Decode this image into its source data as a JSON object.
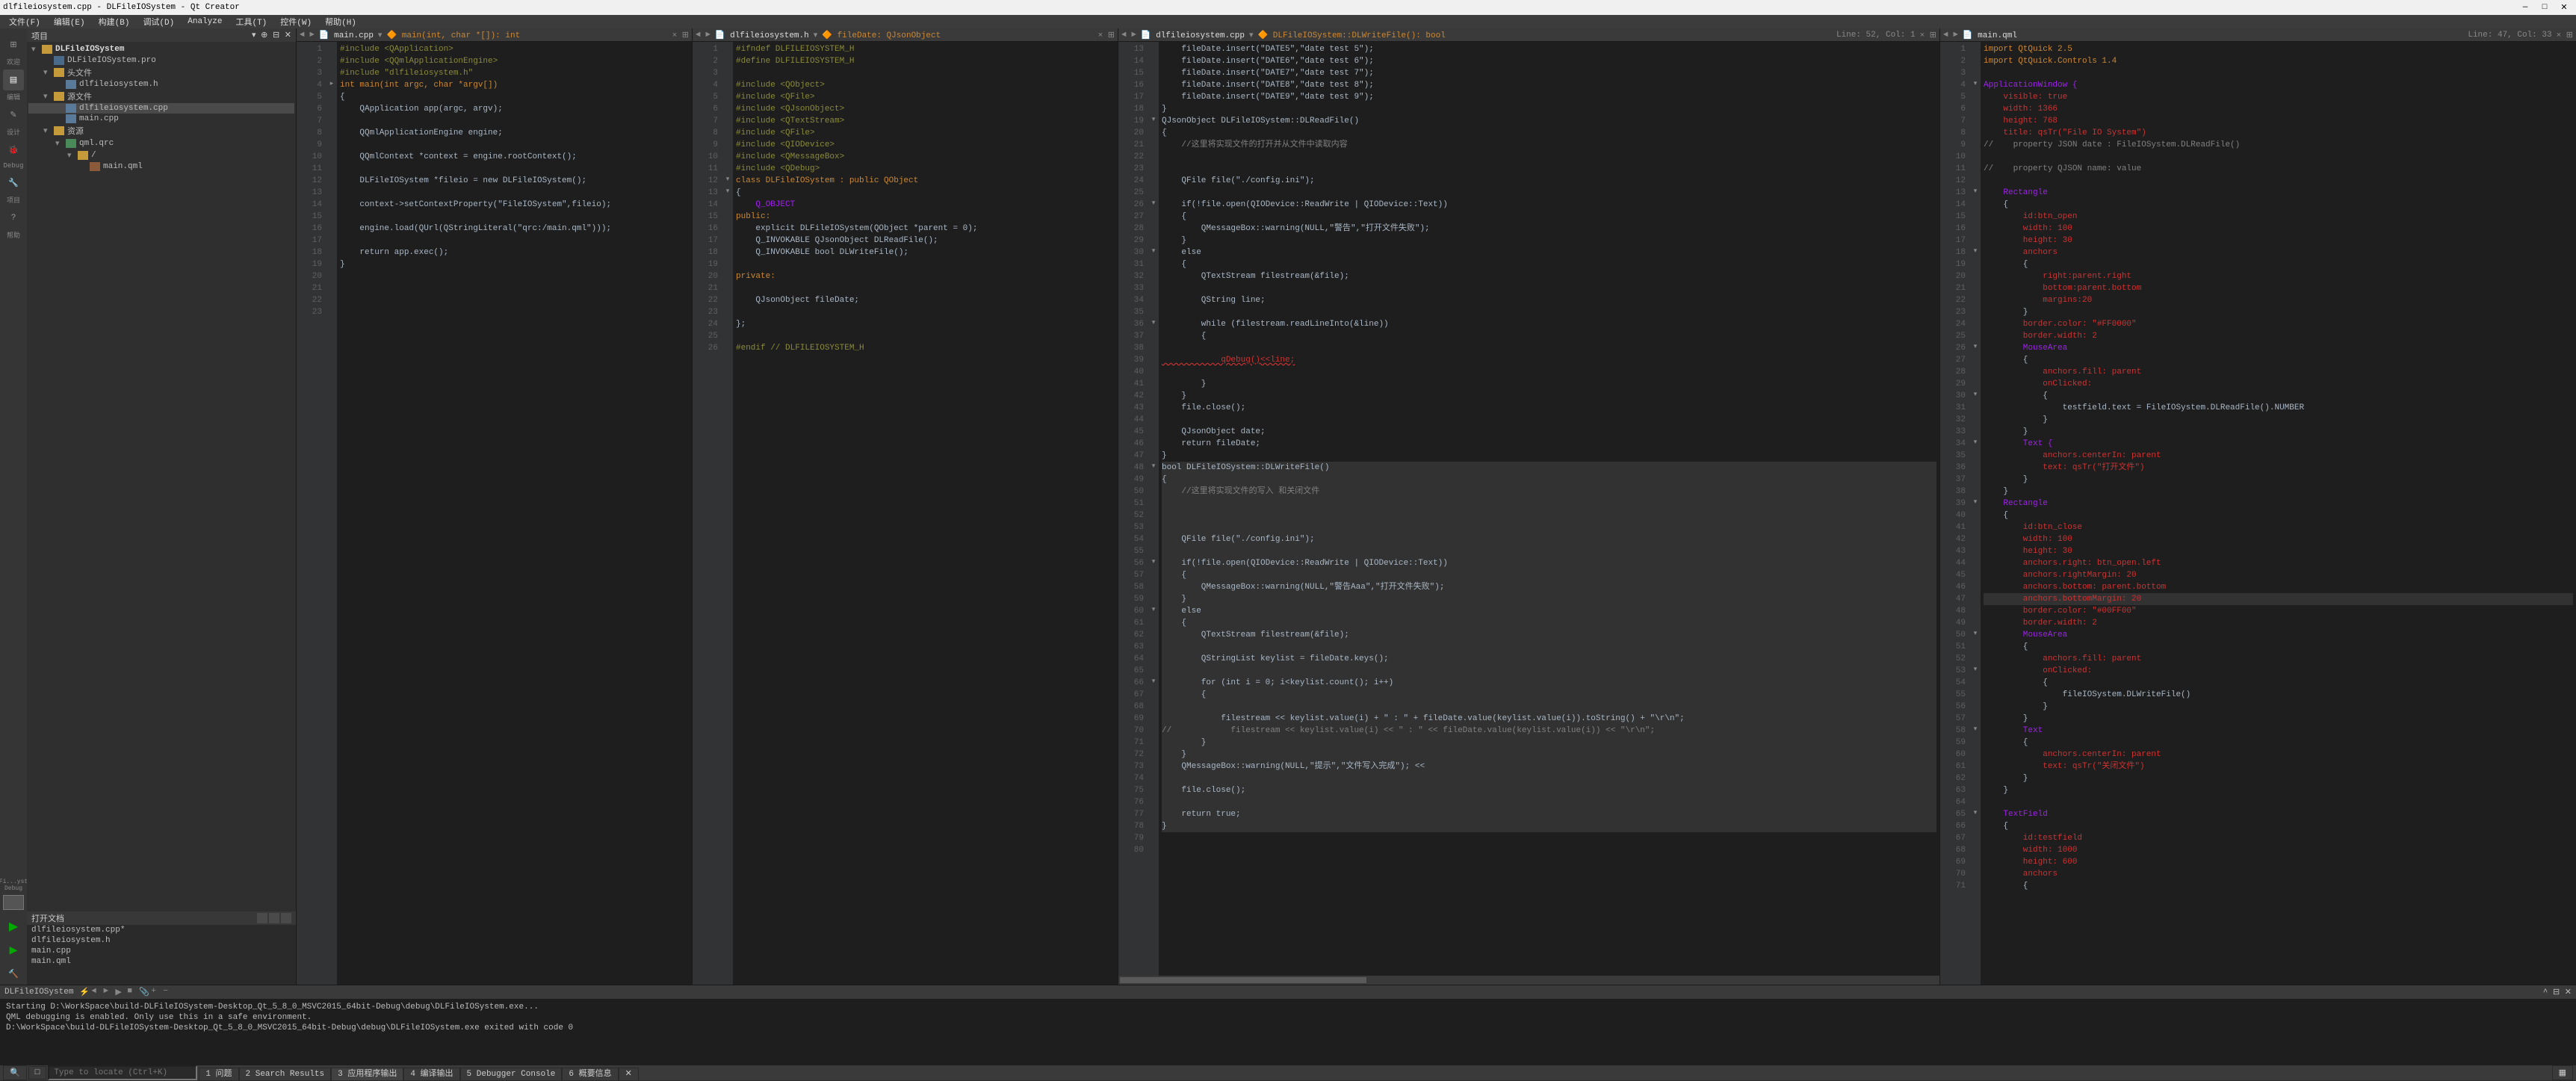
{
  "title": "dlfileiosystem.cpp - DLFileIOSystem - Qt Creator",
  "menu": [
    "文件(F)",
    "编辑(E)",
    "构建(B)",
    "调试(D)",
    "Analyze",
    "工具(T)",
    "控件(W)",
    "帮助(H)"
  ],
  "project_header": "项目",
  "tree": [
    {
      "d": 0,
      "exp": "▾",
      "ico": "folder",
      "txt": "DLFileIOSystem",
      "bold": true
    },
    {
      "d": 1,
      "exp": " ",
      "ico": "folderb",
      "txt": "DLFileIOSystem.pro"
    },
    {
      "d": 1,
      "exp": "▾",
      "ico": "folder",
      "txt": "头文件"
    },
    {
      "d": 2,
      "exp": " ",
      "ico": "h",
      "txt": "dlfileiosystem.h"
    },
    {
      "d": 1,
      "exp": "▾",
      "ico": "folder",
      "txt": "源文件"
    },
    {
      "d": 2,
      "exp": " ",
      "ico": "cpp",
      "txt": "dlfileiosystem.cpp",
      "sel": true
    },
    {
      "d": 2,
      "exp": " ",
      "ico": "cpp",
      "txt": "main.cpp"
    },
    {
      "d": 1,
      "exp": "▾",
      "ico": "folder",
      "txt": "资源"
    },
    {
      "d": 2,
      "exp": "▾",
      "ico": "qrc",
      "txt": "qml.qrc"
    },
    {
      "d": 3,
      "exp": "▾",
      "ico": "folder",
      "txt": "/"
    },
    {
      "d": 4,
      "exp": " ",
      "ico": "qml",
      "txt": "main.qml"
    }
  ],
  "open_header": "打开文档",
  "open_files": [
    "dlfileiosystem.cpp*",
    "dlfileiosystem.h",
    "main.cpp",
    "main.qml"
  ],
  "editors": [
    {
      "tab": {
        "nav": "◄ ►",
        "ico": "cpp",
        "fname": "main.cpp",
        "func": "main(int, char *[]): int",
        "x": "×  ⊞"
      },
      "start": 1,
      "lines": [
        {
          "t": "#include <QApplication>",
          "cls": "pp"
        },
        {
          "t": "#include <QQmlApplicationEngine>",
          "cls": "pp"
        },
        {
          "t": "#include \"dlfileiosystem.h\"",
          "cls": "pp"
        },
        {
          "t": "int main(int argc, char *argv[])",
          "cls": "kw",
          "fold": "▸"
        },
        {
          "t": "{"
        },
        {
          "t": "    QApplication app(argc, argv);"
        },
        {
          "t": ""
        },
        {
          "t": "    QQmlApplicationEngine engine;"
        },
        {
          "t": ""
        },
        {
          "t": "    QQmlContext *context = engine.rootContext();"
        },
        {
          "t": ""
        },
        {
          "t": "    DLFileIOSystem *fileio = new DLFileIOSystem();"
        },
        {
          "t": ""
        },
        {
          "t": "    context->setContextProperty(\"FileIOSystem\",fileio);"
        },
        {
          "t": ""
        },
        {
          "t": "    engine.load(QUrl(QStringLiteral(\"qrc:/main.qml\")));"
        },
        {
          "t": ""
        },
        {
          "t": "    return app.exec();"
        },
        {
          "t": "}"
        },
        {
          "t": ""
        },
        {
          "t": ""
        },
        {
          "t": ""
        },
        {
          "t": ""
        }
      ]
    },
    {
      "tab": {
        "nav": "◄ ►",
        "ico": "h",
        "fname": "dlfileiosystem.h",
        "func": "fileDate: QJsonObject",
        "x": "×  ⊞"
      },
      "start": 1,
      "lines": [
        {
          "t": "#ifndef DLFILEIOSYSTEM_H",
          "cls": "pp"
        },
        {
          "t": "#define DLFILEIOSYSTEM_H",
          "cls": "pp"
        },
        {
          "t": ""
        },
        {
          "t": "#include <QObject>",
          "cls": "pp"
        },
        {
          "t": "#include <QFile>",
          "cls": "pp"
        },
        {
          "t": "#include <QJsonObject>",
          "cls": "pp"
        },
        {
          "t": "#include <QTextStream>",
          "cls": "pp"
        },
        {
          "t": "#include <QFile>",
          "cls": "pp"
        },
        {
          "t": "#include <QIODevice>",
          "cls": "pp"
        },
        {
          "t": "#include <QMessageBox>",
          "cls": "pp"
        },
        {
          "t": "#include <QDebug>",
          "cls": "pp"
        },
        {
          "t": "class DLFileIOSystem : public QObject",
          "cls": "kw",
          "fold": "▾"
        },
        {
          "t": "{",
          "fold": "▾"
        },
        {
          "t": "    Q_OBJECT",
          "cls": "typ"
        },
        {
          "t": "public:",
          "cls": "kw"
        },
        {
          "t": "    explicit DLFileIOSystem(QObject *parent = 0);"
        },
        {
          "t": "    Q_INVOKABLE QJsonObject DLReadFile();"
        },
        {
          "t": "    Q_INVOKABLE bool DLWriteFile();"
        },
        {
          "t": ""
        },
        {
          "t": "private:",
          "cls": "kw"
        },
        {
          "t": ""
        },
        {
          "t": "    QJsonObject fileDate;"
        },
        {
          "t": ""
        },
        {
          "t": "};"
        },
        {
          "t": ""
        },
        {
          "t": "#endif // DLFILEIOSYSTEM_H",
          "cls": "pp"
        }
      ]
    },
    {
      "tab": {
        "nav": "◄ ►",
        "ico": "cpp",
        "fname": "dlfileiosystem.cpp",
        "func": "DLFileIOSystem::DLWriteFile(): bool",
        "x": "×  ⊞",
        "lineinfo": "Line: 52, Col: 1"
      },
      "start": 13,
      "lines": [
        {
          "t": "    fileDate.insert(\"DATE5\",\"date test 5\");"
        },
        {
          "t": "    fileDate.insert(\"DATE6\",\"date test 6\");"
        },
        {
          "t": "    fileDate.insert(\"DATE7\",\"date test 7\");"
        },
        {
          "t": "    fileDate.insert(\"DATE8\",\"date test 8\");"
        },
        {
          "t": "    fileDate.insert(\"DATE9\",\"date test 9\");"
        },
        {
          "t": "}"
        },
        {
          "t": "QJsonObject DLFileIOSystem::DLReadFile()",
          "fold": "▾"
        },
        {
          "t": "{"
        },
        {
          "t": "    //这里将实现文件的打开并从文件中读取内容",
          "cls": "cmt"
        },
        {
          "t": ""
        },
        {
          "t": ""
        },
        {
          "t": "    QFile file(\"./config.ini\");"
        },
        {
          "t": ""
        },
        {
          "t": "    if(!file.open(QIODevice::ReadWrite | QIODevice::Text))",
          "fold": "▾"
        },
        {
          "t": "    {"
        },
        {
          "t": "        QMessageBox::warning(NULL,\"警告\",\"打开文件失败\");"
        },
        {
          "t": "    }"
        },
        {
          "t": "    else",
          "fold": "▾"
        },
        {
          "t": "    {"
        },
        {
          "t": "        QTextStream filestream(&file);"
        },
        {
          "t": ""
        },
        {
          "t": "        QString line;"
        },
        {
          "t": ""
        },
        {
          "t": "        while (filestream.readLineInto(&line))",
          "fold": "▾"
        },
        {
          "t": "        {"
        },
        {
          "t": ""
        },
        {
          "t": "            qDebug()<<line;",
          "cls": "err"
        },
        {
          "t": ""
        },
        {
          "t": "        }"
        },
        {
          "t": "    }"
        },
        {
          "t": "    file.close();"
        },
        {
          "t": ""
        },
        {
          "t": "    QJsonObject date;"
        },
        {
          "t": "    return fileDate;"
        },
        {
          "t": "}"
        },
        {
          "t": "bool DLFileIOSystem::DLWriteFile()",
          "fold": "▾",
          "hl": true
        },
        {
          "t": "{",
          "hl": true
        },
        {
          "t": "    //这里将实现文件的写入 和关闭文件",
          "cls": "cmt",
          "hl": true
        },
        {
          "t": "",
          "hl": true
        },
        {
          "t": "",
          "hl": true,
          "cur": true
        },
        {
          "t": "",
          "hl": true
        },
        {
          "t": "    QFile file(\"./config.ini\");",
          "hl": true
        },
        {
          "t": "",
          "hl": true
        },
        {
          "t": "    if(!file.open(QIODevice::ReadWrite | QIODevice::Text))",
          "fold": "▾",
          "hl": true
        },
        {
          "t": "    {",
          "hl": true
        },
        {
          "t": "        QMessageBox::warning(NULL,\"警告Aaa\",\"打开文件失败\");",
          "hl": true
        },
        {
          "t": "    }",
          "hl": true
        },
        {
          "t": "    else",
          "fold": "▾",
          "hl": true
        },
        {
          "t": "    {",
          "hl": true
        },
        {
          "t": "        QTextStream filestream(&file);",
          "hl": true
        },
        {
          "t": "",
          "hl": true
        },
        {
          "t": "        QStringList keylist = fileDate.keys();",
          "hl": true
        },
        {
          "t": "",
          "hl": true
        },
        {
          "t": "        for (int i = 0; i<keylist.count(); i++)",
          "fold": "▾",
          "hl": true
        },
        {
          "t": "        {",
          "hl": true
        },
        {
          "t": "",
          "hl": true
        },
        {
          "t": "            filestream << keylist.value(i) + \" : \" + fileDate.value(keylist.value(i)).toString() + \"\\r\\n\";",
          "hl": true
        },
        {
          "t": "//            filestream << keylist.value(i) << \" : \" << fileDate.value(keylist.value(i)) << \"\\r\\n\";",
          "cls": "cmt",
          "hl": true
        },
        {
          "t": "        }",
          "hl": true
        },
        {
          "t": "    }",
          "hl": true
        },
        {
          "t": "    QMessageBox::warning(NULL,\"提示\",\"文件写入完成\"); <<",
          "hl": true
        },
        {
          "t": "",
          "hl": true
        },
        {
          "t": "    file.close();",
          "hl": true
        },
        {
          "t": "",
          "hl": true
        },
        {
          "t": "    return true;",
          "hl": true
        },
        {
          "t": "}",
          "hl": true
        },
        {
          "t": ""
        },
        {
          "t": ""
        }
      ]
    },
    {
      "tab": {
        "nav": "◄ ►",
        "ico": "qml",
        "fname": "main.qml",
        "x": "×  ⊞",
        "lineinfo": "Line: 47, Col: 33"
      },
      "start": 1,
      "lines": [
        {
          "t": "import QtQuick 2.5",
          "cls": "kw"
        },
        {
          "t": "import QtQuick.Controls 1.4",
          "cls": "kw"
        },
        {
          "t": ""
        },
        {
          "t": "ApplicationWindow {",
          "cls": "qml",
          "fold": "▾"
        },
        {
          "t": "    visible: true",
          "cls": "prop"
        },
        {
          "t": "    width: 1366",
          "cls": "prop"
        },
        {
          "t": "    height: 768",
          "cls": "prop"
        },
        {
          "t": "    title: qsTr(\"File IO System\")",
          "cls": "prop"
        },
        {
          "t": "//    property JSON date : FileIOSystem.DLReadFile()",
          "cls": "cmt"
        },
        {
          "t": ""
        },
        {
          "t": "//    property QJSON name: value",
          "cls": "cmt"
        },
        {
          "t": ""
        },
        {
          "t": "    Rectangle",
          "cls": "qml",
          "fold": "▾"
        },
        {
          "t": "    {"
        },
        {
          "t": "        id:btn_open",
          "cls": "prop"
        },
        {
          "t": "        width: 100",
          "cls": "prop"
        },
        {
          "t": "        height: 30",
          "cls": "prop"
        },
        {
          "t": "        anchors",
          "cls": "prop",
          "fold": "▾"
        },
        {
          "t": "        {"
        },
        {
          "t": "            right:parent.right",
          "cls": "prop"
        },
        {
          "t": "            bottom:parent.bottom",
          "cls": "prop"
        },
        {
          "t": "            margins:20",
          "cls": "prop"
        },
        {
          "t": "        }"
        },
        {
          "t": "        border.color: \"#FF0000\"",
          "cls": "prop"
        },
        {
          "t": "        border.width: 2",
          "cls": "prop"
        },
        {
          "t": "        MouseArea",
          "cls": "qml",
          "fold": "▾"
        },
        {
          "t": "        {"
        },
        {
          "t": "            anchors.fill: parent",
          "cls": "prop"
        },
        {
          "t": "            onClicked:",
          "cls": "prop"
        },
        {
          "t": "            {",
          "fold": "▾"
        },
        {
          "t": "                testfield.text = FileIOSystem.DLReadFile().NUMBER"
        },
        {
          "t": "            }"
        },
        {
          "t": "        }"
        },
        {
          "t": "        Text {",
          "cls": "qml",
          "fold": "▾"
        },
        {
          "t": "            anchors.centerIn: parent",
          "cls": "prop"
        },
        {
          "t": "            text: qsTr(\"打开文件\")",
          "cls": "prop"
        },
        {
          "t": "        }"
        },
        {
          "t": "    }"
        },
        {
          "t": "    Rectangle",
          "cls": "qml",
          "fold": "▾"
        },
        {
          "t": "    {"
        },
        {
          "t": "        id:btn_close",
          "cls": "prop"
        },
        {
          "t": "        width: 100",
          "cls": "prop"
        },
        {
          "t": "        height: 30",
          "cls": "prop"
        },
        {
          "t": "        anchors.right: btn_open.left",
          "cls": "prop"
        },
        {
          "t": "        anchors.rightMargin: 20",
          "cls": "prop"
        },
        {
          "t": "        anchors.bottom: parent.bottom",
          "cls": "prop"
        },
        {
          "t": "        anchors.bottomMargin: 20",
          "cls": "prop",
          "hl": true
        },
        {
          "t": "        border.color: \"#00FF00\"",
          "cls": "prop"
        },
        {
          "t": "        border.width: 2",
          "cls": "prop"
        },
        {
          "t": "        MouseArea",
          "cls": "qml",
          "fold": "▾"
        },
        {
          "t": "        {"
        },
        {
          "t": "            anchors.fill: parent",
          "cls": "prop"
        },
        {
          "t": "            onClicked:",
          "cls": "prop",
          "fold": "▾"
        },
        {
          "t": "            {"
        },
        {
          "t": "                fileIOSystem.DLWriteFile()"
        },
        {
          "t": "            }"
        },
        {
          "t": "        }"
        },
        {
          "t": "        Text",
          "cls": "qml",
          "fold": "▾"
        },
        {
          "t": "        {"
        },
        {
          "t": "            anchors.centerIn: parent",
          "cls": "prop"
        },
        {
          "t": "            text: qsTr(\"关闭文件\")",
          "cls": "prop"
        },
        {
          "t": "        }"
        },
        {
          "t": "    }"
        },
        {
          "t": ""
        },
        {
          "t": "    TextField",
          "cls": "qml",
          "fold": "▾"
        },
        {
          "t": "    {"
        },
        {
          "t": "        id:testfield",
          "cls": "prop"
        },
        {
          "t": "        width: 1000",
          "cls": "prop"
        },
        {
          "t": "        height: 600",
          "cls": "prop"
        },
        {
          "t": "        anchors",
          "cls": "prop"
        },
        {
          "t": "        {"
        }
      ]
    }
  ],
  "output_title": "DLFileIOSystem",
  "output_lines": [
    "Starting D:\\WorkSpace\\build-DLFileIOSystem-Desktop_Qt_5_8_0_MSVC2015_64bit-Debug\\debug\\DLFileIOSystem.exe...",
    "QML debugging is enabled. Only use this in a safe environment.",
    "D:\\WorkSpace\\build-DLFileIOSystem-Desktop_Qt_5_8_0_MSVC2015_64bit-Debug\\debug\\DLFileIOSystem.exe exited with code 0"
  ],
  "status_items": [
    "1 问题",
    "2 Search Results",
    "3 应用程序输出",
    "4 编译输出",
    "5 Debugger Console",
    "6 概要信息"
  ],
  "locator_placeholder": "Type to locate (Ctrl+K)",
  "leftbar_labels": {
    "welcome": "欢迎",
    "edit": "编辑",
    "design": "设计",
    "debug": "Debug",
    "project": "项目",
    "help": "帮助"
  },
  "leftbar_target": "DLFi...ystem\nDebug"
}
